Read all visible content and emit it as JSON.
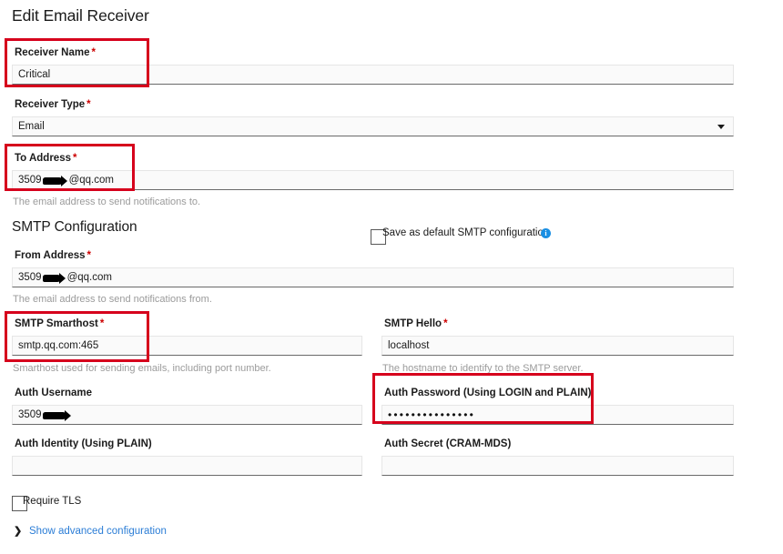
{
  "page": {
    "title": "Edit Email Receiver",
    "section_title": "SMTP Configuration"
  },
  "fields": {
    "receiver_name": {
      "label": "Receiver Name",
      "required": "*",
      "value": "Critical"
    },
    "receiver_type": {
      "label": "Receiver Type",
      "required": "*",
      "value": "Email",
      "caret": "chevron-down-icon"
    },
    "to_address": {
      "label": "To Address",
      "required": "*",
      "value_prefix": "3509",
      "value_suffix": "@qq.com",
      "help": "The email address to send notifications to."
    },
    "from_address": {
      "label": "From Address",
      "required": "*",
      "value_prefix": "3509",
      "value_suffix": "@qq.com",
      "help": "The email address to send notifications from."
    },
    "smtp_smarthost": {
      "label": "SMTP Smarthost",
      "required": "*",
      "value": "smtp.qq.com:465",
      "help": "Smarthost used for sending emails, including port number."
    },
    "smtp_hello": {
      "label": "SMTP Hello",
      "required": "*",
      "value": "localhost",
      "help": "The hostname to identify to the SMTP server."
    },
    "auth_username": {
      "label": "Auth Username",
      "value_prefix": "3509"
    },
    "auth_password": {
      "label": "Auth Password (Using LOGIN and PLAIN)",
      "value": "•••••••••••••••"
    },
    "auth_identity": {
      "label": "Auth Identity (Using PLAIN)",
      "value": ""
    },
    "auth_secret": {
      "label": "Auth Secret (CRAM-MDS)",
      "value": ""
    }
  },
  "checkboxes": {
    "save_default_smtp": {
      "label": "Save as default SMTP configuration",
      "checked": false,
      "info": "i"
    },
    "require_tls": {
      "label": "Require TLS",
      "checked": false
    }
  },
  "links": {
    "show_advanced": {
      "label": "Show advanced configuration",
      "chevron": "❯"
    }
  },
  "colors": {
    "annotation_red": "#d6001c",
    "required_red": "#cc0000",
    "link_blue": "#2b7dd6",
    "info_blue": "#1a8fe3",
    "help_gray": "#9b9b9b"
  }
}
